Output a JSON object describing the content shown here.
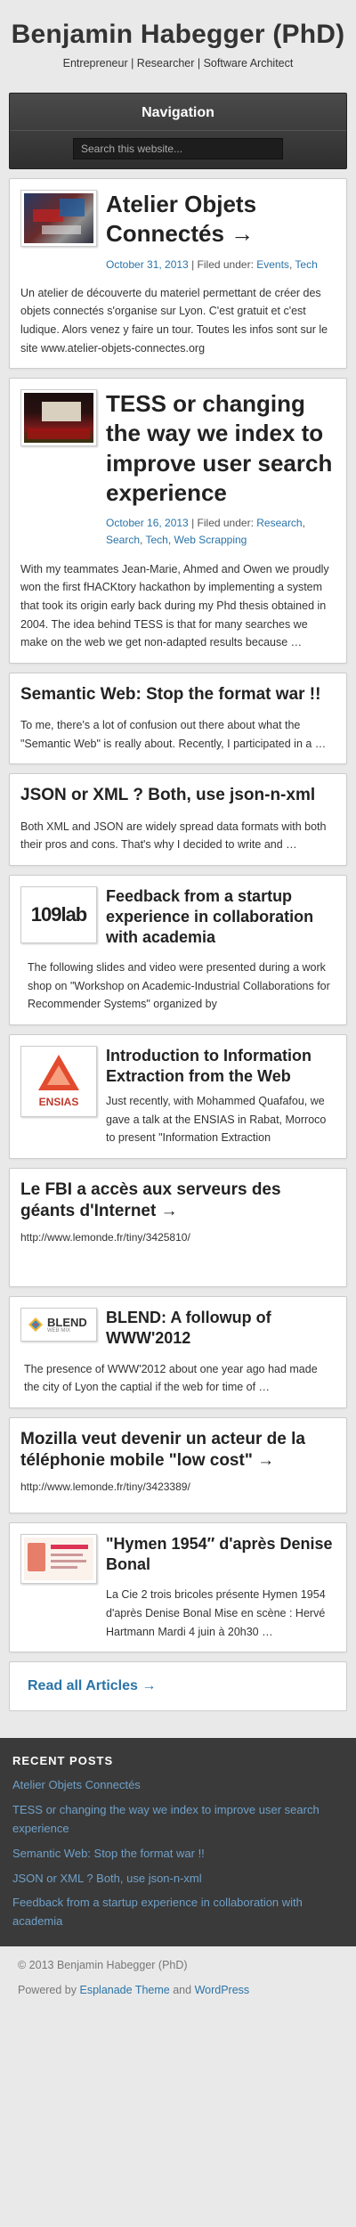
{
  "header": {
    "title": "Benjamin Habegger (PhD)",
    "tagline": "Entrepreneur | Researcher | Software Architect"
  },
  "nav": {
    "title": "Navigation",
    "search_placeholder": "Search this website..."
  },
  "posts": [
    {
      "title": "Atelier Objets Connectés →",
      "date": "October 31, 2013",
      "filed_label": "| Filed under:",
      "categories": [
        "Events",
        "Tech"
      ],
      "excerpt": "Un atelier de découverte du materiel permettant de créer des objets connectés s'organise sur Lyon. C'est gratuit et c'est ludique. Alors venez y faire un tour. Toutes les infos sont sur le site www.atelier-objets-connectes.org"
    },
    {
      "title": "TESS or changing the way we index to improve user search experience",
      "date": "October 16, 2013",
      "filed_label": "| Filed under:",
      "categories": [
        "Research",
        "Search",
        "Tech",
        "Web Scrapping"
      ],
      "excerpt": "With my teammates Jean-Marie, Ahmed and Owen we proudly won the first fHACKtory hackathon by implementing a system that took its origin early back during my Phd thesis obtained in 2004. The idea behind TESS is that for many searches we make on the web we get non-adapted results because …"
    },
    {
      "title": "Semantic Web: Stop the format war !!",
      "excerpt": "To me, there's a lot of confusion out there about what the \"Semantic Web\" is really about. Recently, I participated in a …"
    },
    {
      "title": "JSON or XML ? Both, use json-n-xml",
      "excerpt": "Both XML and JSON are widely spread data formats with both their pros and cons. That's why I decided to write and …"
    },
    {
      "title": "Feedback from a startup experience in collaboration with academia",
      "logo_text": "109lab",
      "excerpt": "The following slides and video were presented during a work shop on \"Workshop on Academic-Industrial Collaborations for Recommender Systems\" organized by"
    },
    {
      "title": "Introduction to Information Extraction from the Web",
      "logo_text": "ENSIAS",
      "excerpt": "Just recently, with Mohammed Quafafou, we gave a talk at the ENSIAS in Rabat, Morroco to present \"Information Extraction"
    },
    {
      "title": "Le FBI a accès aux serveurs des géants d'Internet →",
      "url": "http://www.lemonde.fr/tiny/3425810/"
    },
    {
      "title": "BLEND: A followup of WWW'2012",
      "logo_text": "BLEND",
      "logo_sub": "WEB MIX",
      "excerpt": "The presence of WWW'2012 about one year ago had made the city of Lyon the captial if the web for time of …"
    },
    {
      "title": "Mozilla veut devenir un acteur de la téléphonie mobile \"low cost\" →",
      "url": "http://www.lemonde.fr/tiny/3423389/"
    },
    {
      "title": "\"Hymen 1954″ d'après Denise Bonal",
      "excerpt": "La Cie 2 trois bricoles présente Hymen 1954 d'après Denise Bonal Mise en scène : Hervé Hartmann Mardi 4 juin à 20h30 …"
    }
  ],
  "read_all": "Read all Articles →",
  "sidebar": {
    "title": "RECENT POSTS",
    "items": [
      "Atelier Objets Connectés",
      "TESS or changing the way we index to improve user search experience",
      "Semantic Web: Stop the format war !!",
      "JSON or XML ? Both, use json-n-xml",
      "Feedback from a startup experience in collaboration with academia"
    ]
  },
  "footer": {
    "copyright": "© 2013 Benjamin Habegger (PhD)",
    "powered_prefix": "Powered by",
    "theme_link": "Esplanade Theme",
    "and": "and",
    "wp_link": "WordPress"
  }
}
